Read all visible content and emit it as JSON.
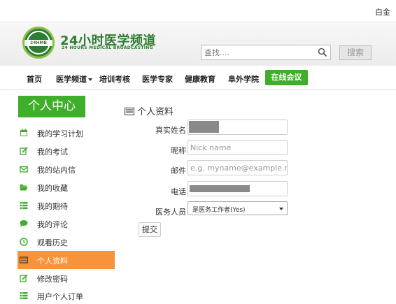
{
  "topbar": {
    "user_text": "白金"
  },
  "header": {
    "logo_title": "24小时医学频道",
    "logo_subtitle": "24 HOURS MEDICAL BROADCASTING",
    "logo_badge_text": "24HMB",
    "search_placeholder": "查找....",
    "search_button": "搜索"
  },
  "nav": {
    "items": [
      "首页",
      "医学频道",
      "培训考核",
      "医学专家",
      "健康教育",
      "阜外学院"
    ],
    "active": "在线会议"
  },
  "sidebar": {
    "title": "个人中心",
    "items": [
      {
        "label": "我的学习计划",
        "icon": "calendar-icon"
      },
      {
        "label": "我的考试",
        "icon": "edit-icon"
      },
      {
        "label": "我的站内信",
        "icon": "envelope-icon"
      },
      {
        "label": "我的收藏",
        "icon": "folder-open-icon"
      },
      {
        "label": "我的期待",
        "icon": "list-icon"
      },
      {
        "label": "我的评论",
        "icon": "comment-icon"
      },
      {
        "label": "观看历史",
        "icon": "clock-icon"
      },
      {
        "label": "个人资料",
        "icon": "id-card-icon",
        "active": true
      },
      {
        "label": "修改密码",
        "icon": "edit-icon"
      },
      {
        "label": "用户个人订单",
        "icon": "list-icon"
      }
    ]
  },
  "profile": {
    "title": "个人资料",
    "fields": {
      "real_name_label": "真实姓名",
      "nickname_label": "昵称",
      "nickname_placeholder": "Nick name",
      "email_label": "邮件",
      "email_placeholder": "e.g. myname@example.net",
      "phone_label": "电话",
      "medical_label": "医务人员",
      "medical_value": "是医务工作者(Yes)"
    },
    "submit": "提交"
  },
  "colors": {
    "brand_green": "#3fae2a",
    "active_orange": "#f7943b",
    "logo_green": "#2f7d32"
  }
}
